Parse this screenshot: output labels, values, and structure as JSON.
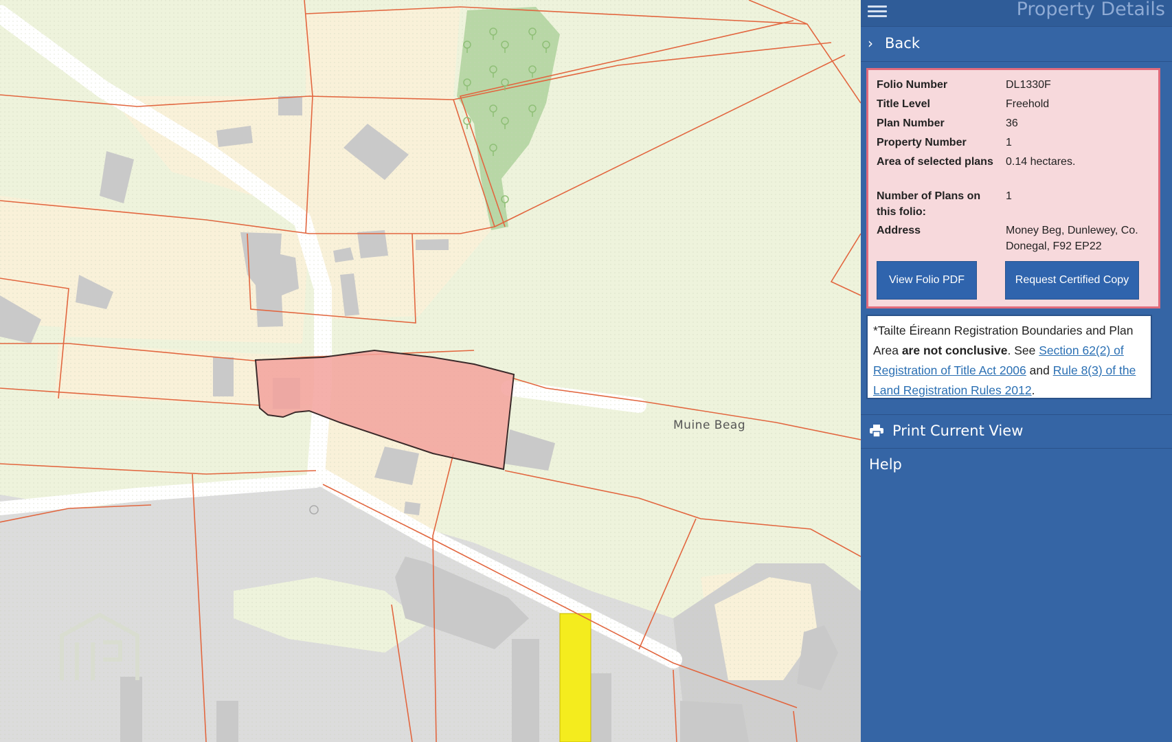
{
  "map": {
    "place_label": "Muine Beag",
    "colors": {
      "land": "#eef3dc",
      "parcel_fill": "#f9f1d9",
      "boundary": "#e2663f",
      "selected_parcel": "#f3a29c",
      "selected_outline": "#3a2a2a",
      "highlight": "#f4ec1e",
      "building": "#c9c9c9",
      "road": "#ffffff",
      "paved": "#dcdcdc",
      "woodland": "#b8d7a6"
    },
    "icons": [
      "tree-icon",
      "watermark-logo-icon"
    ]
  },
  "panel": {
    "title": "Property Details",
    "back_label": "Back",
    "details": [
      {
        "label": "Folio Number",
        "value": "DL1330F"
      },
      {
        "label": "Title Level",
        "value": "Freehold"
      },
      {
        "label": "Plan Number",
        "value": "36"
      },
      {
        "label": "Property Number",
        "value": "1"
      },
      {
        "label": "Area of selected plans",
        "value": "0.14 hectares."
      },
      {
        "label": "Number of Plans on this folio:",
        "value": "1"
      },
      {
        "label": "Address",
        "value": "Money Beg, Dunlewey, Co. Donegal, F92 EP22"
      }
    ],
    "buttons": {
      "view_folio": "View Folio PDF",
      "request_copy": "Request Certified Copy"
    },
    "disclaimer": {
      "prefix": "*Tailte Éireann Registration Boundaries and Plan Area ",
      "bold": "are not conclusive",
      "middle": ". See ",
      "link1": "Section 62(2) of Registration of Title Act 2006",
      "and": " and ",
      "link2": "Rule 8(3) of the Land Registration Rules 2012",
      "end": "."
    },
    "print_label": "Print Current View",
    "help_label": "Help"
  }
}
